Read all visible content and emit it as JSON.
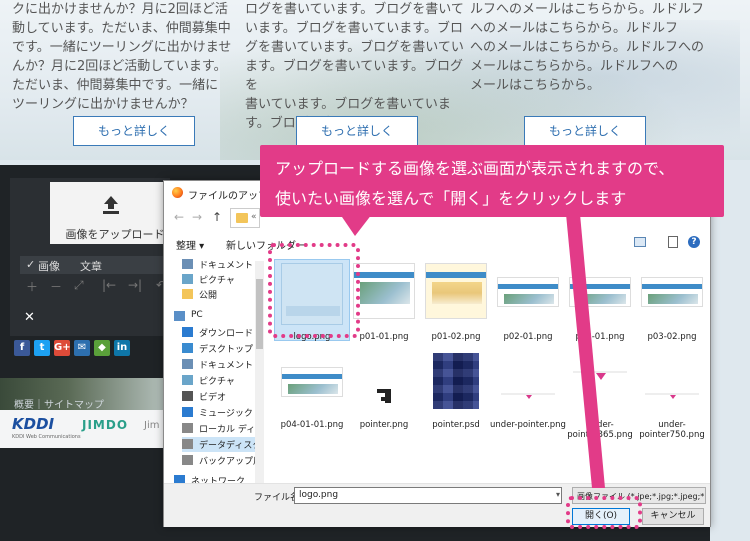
{
  "site": {
    "col1_lines": [
      "クに出かけませんか？月に2回ほど活",
      "動しています。ただいま、仲間募集中",
      "です。一緒にツーリングに出かけませ",
      "んか？月に2回ほど活動しています。",
      "ただいま、仲間募集中です。一緒に",
      "ツーリングに出かけませんか？"
    ],
    "col2_lines": [
      "ログを書いています。ブログを書いて",
      "います。ブログを書いています。ブロ",
      "グを書いています。ブログを書いてい",
      "ます。ブログを書いています。ブログを",
      "書いています。ブログを書いていま",
      "す。ブログを書いています。"
    ],
    "col3_lines": [
      "ルフへのメールはこちらから。ルドルフ",
      "へのメールはこちらから。ルドルフ",
      "へのメールはこちらから。ルドルフへの",
      "メールはこちらから。ルドルフへの",
      "メールはこちらから。"
    ],
    "more_label": "もっと詳しく",
    "editor": {
      "upload_label": "画像をアップロード",
      "tab_image": "画像",
      "tab_text": "文章",
      "tool_plus": "＋",
      "tool_minus": "－",
      "tool_fit": "⤢",
      "tool_left": "|←",
      "tool_right": "→|",
      "tool_undo": "↶",
      "close": "✕"
    },
    "social": [
      {
        "label": "f",
        "color": "#3b5998"
      },
      {
        "label": "t",
        "color": "#1da1f2"
      },
      {
        "label": "G+",
        "color": "#dd4b39"
      },
      {
        "label": "✉",
        "color": "#2d6fae"
      },
      {
        "label": "◆",
        "color": "#5aa03a"
      },
      {
        "label": "in",
        "color": "#0e76a8"
      }
    ],
    "footer_links": "概要｜サイトマップ",
    "kddi": "KDDI",
    "kddi_sub": "KDDI Web Communications",
    "jimdo": "JIMDO",
    "jim2": "Jim"
  },
  "dialog": {
    "title": "ファイルのアップロード",
    "nav_back": "←",
    "nav_forward": "→",
    "nav_up": "↑",
    "addr_text": "«",
    "organize": "整理 ▾",
    "new_folder": "新しいフォルダー",
    "help": "?",
    "nav_items": [
      {
        "label": "ドキュメント",
        "icon": "document-icon",
        "color": "#6b8fb5"
      },
      {
        "label": "ピクチャ",
        "icon": "picture-icon",
        "color": "#6aa5c9"
      },
      {
        "label": "公開",
        "icon": "folder-icon",
        "color": "#f3c55a"
      },
      {
        "label": "PC",
        "icon": "pc-icon",
        "color": "#5a8fc7"
      },
      {
        "label": "ダウンロード",
        "icon": "download-icon",
        "color": "#2b7bd0"
      },
      {
        "label": "デスクトップ",
        "icon": "desktop-icon",
        "color": "#3a8bd0"
      },
      {
        "label": "ドキュメント",
        "icon": "document-icon",
        "color": "#6b8fb5"
      },
      {
        "label": "ピクチャ",
        "icon": "picture-icon",
        "color": "#6aa5c9"
      },
      {
        "label": "ビデオ",
        "icon": "video-icon",
        "color": "#555"
      },
      {
        "label": "ミュージック",
        "icon": "music-icon",
        "color": "#2b7bd0"
      },
      {
        "label": "ローカル ディスク (C",
        "icon": "disk-icon",
        "color": "#888"
      },
      {
        "label": "データディスク (D:)",
        "icon": "disk-icon",
        "color": "#888"
      },
      {
        "label": "バックアップ用古い",
        "icon": "disk-icon",
        "color": "#888"
      },
      {
        "label": "ネットワーク",
        "icon": "network-icon",
        "color": "#2b7bd0"
      }
    ],
    "files": [
      {
        "name": "logo.png",
        "kind": "logo"
      },
      {
        "name": "p01-01.png",
        "kind": "shot"
      },
      {
        "name": "p01-02.png",
        "kind": "yellow"
      },
      {
        "name": "p02-01.png",
        "kind": "wide"
      },
      {
        "name": "p03-01.png",
        "kind": "wide"
      },
      {
        "name": "p03-02.png",
        "kind": "wide"
      },
      {
        "name": "p04-01-01.png",
        "kind": "wide"
      },
      {
        "name": "pointer.png",
        "kind": "pointer"
      },
      {
        "name": "pointer.psd",
        "kind": "pixel"
      },
      {
        "name": "under-pointer.png",
        "kind": "ptr-small"
      },
      {
        "name": "under-pointer365.png",
        "kind": "ptr-big"
      },
      {
        "name": "under-pointer750.png",
        "kind": "ptr-small"
      }
    ],
    "filename_label": "ファイル名(N):",
    "filename_value": "logo.png",
    "filetype_value": "画像ファイル (*.jpe;*.jpg;*.jpeg;*.g",
    "open_label": "開く(O)",
    "cancel_label": "キャンセル"
  },
  "annotation": {
    "line1": "アップロードする画像を選ぶ画面が表示されますので、",
    "line2": "使いたい画像を選んで「開く」をクリックします",
    "color": "#e23b88"
  }
}
